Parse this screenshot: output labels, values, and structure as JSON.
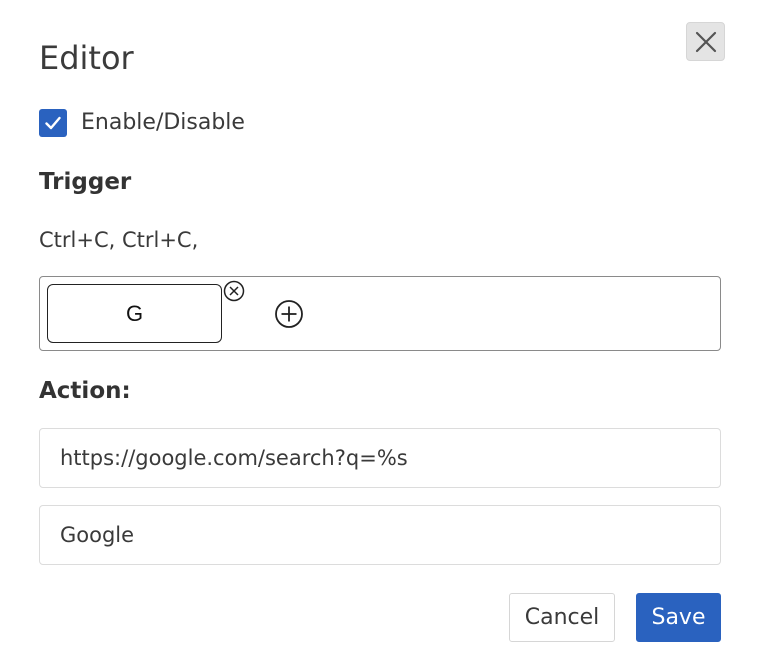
{
  "dialog": {
    "title": "Editor",
    "close_icon": "close-icon"
  },
  "enable": {
    "label": "Enable/Disable",
    "checked": true,
    "accent_color": "#2a62bf"
  },
  "trigger": {
    "heading": "Trigger",
    "sequence_text": "Ctrl+C, Ctrl+C,",
    "keys": [
      "G"
    ],
    "remove_icon": "circle-x-icon",
    "add_icon": "circle-plus-icon"
  },
  "action": {
    "heading": "Action:",
    "url_value": "https://google.com/search?q=%s",
    "name_value": "Google"
  },
  "footer": {
    "cancel_label": "Cancel",
    "save_label": "Save",
    "save_color": "#2a62bf"
  }
}
